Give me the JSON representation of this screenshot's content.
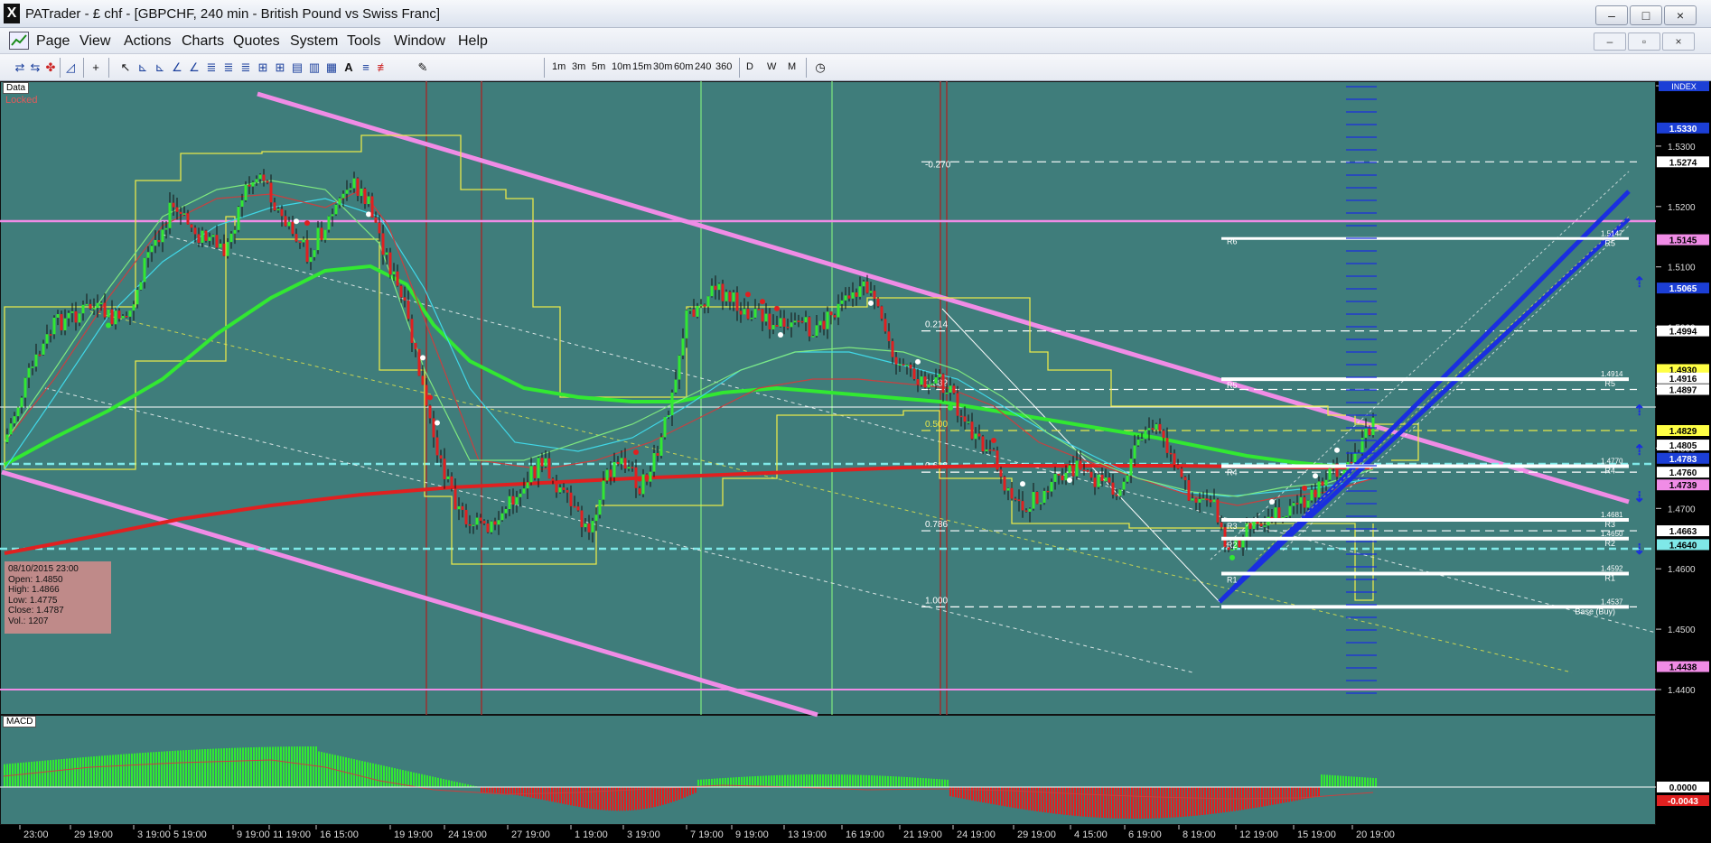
{
  "window": {
    "icon_letter": "X",
    "title": "PATrader - £ chf - [GBPCHF, 240 min - British Pound vs Swiss Franc]",
    "buttons": [
      "–",
      "□",
      "×"
    ],
    "mdi_buttons": [
      "–",
      "▫",
      "×"
    ]
  },
  "menu": [
    "Page",
    "View",
    "Actions",
    "Charts",
    "Quotes",
    "System",
    "Tools",
    "Window",
    "Help"
  ],
  "toolbar": {
    "tools": [
      "connect-icon",
      "disconnect-icon",
      "pin-icon",
      "chart-type-icon",
      "crosshair-icon",
      "pointer-icon",
      "line-tool-icon",
      "channel-tool-icon",
      "ray-tool-icon",
      "fib-tool-icon",
      "fib-fan-icon",
      "fib-arc-icon",
      "fib-time-icon",
      "gann-icon",
      "text-tool-icon",
      "pitchfork-icon",
      "regression-icon",
      "pen-icon"
    ],
    "timeframes": [
      "1m",
      "3m",
      "5m",
      "10m",
      "15m",
      "30m",
      "60m",
      "240",
      "360"
    ],
    "periods": [
      "D",
      "W",
      "M"
    ]
  },
  "chart": {
    "data_tag": "Data",
    "locked": "Locked",
    "index_tag": "INDEX",
    "macd_tag": "MACD",
    "fib_labels": [
      "-0.270",
      "0.214",
      "0.382",
      "0.500",
      "0.618",
      "0.786",
      "1.000"
    ],
    "pivot_labels_left": [
      "R6",
      "R5",
      "R4",
      "R3",
      "R2",
      "R1"
    ],
    "pivot_labels_right": [
      "R5",
      "R5",
      "R4",
      "R3",
      "R2",
      "R1",
      "Base (Buy)"
    ],
    "pivot_values": [
      "1.5147",
      "1.4914",
      "1.4770",
      "1.4681",
      "1.4650",
      "1.4592",
      "1.4537"
    ],
    "price_axis": [
      "1.5400",
      "1.5300",
      "1.5200",
      "1.5100",
      "1.5000",
      "1.4900",
      "1.4800",
      "1.4700",
      "1.4600",
      "1.4500",
      "1.4400"
    ],
    "price_tags": [
      {
        "v": "1.5330",
        "bg": "#1c3fd6",
        "fg": "#ffffff"
      },
      {
        "v": "1.5274",
        "bg": "#ffffff",
        "fg": "#000000"
      },
      {
        "v": "1.5145",
        "bg": "#f08ce6",
        "fg": "#000000"
      },
      {
        "v": "1.5065",
        "bg": "#1c3fd6",
        "fg": "#ffffff"
      },
      {
        "v": "1.4994",
        "bg": "#ffffff",
        "fg": "#000000"
      },
      {
        "v": "1.4930",
        "bg": "#ffff44",
        "fg": "#000000"
      },
      {
        "v": "1.4916",
        "bg": "#ffffff",
        "fg": "#000000"
      },
      {
        "v": "1.4897",
        "bg": "#ffffff",
        "fg": "#000000"
      },
      {
        "v": "1.4829",
        "bg": "#ffff44",
        "fg": "#000000"
      },
      {
        "v": "1.4805",
        "bg": "#ffffff",
        "fg": "#000000"
      },
      {
        "v": "1.4783",
        "bg": "#1c3fd6",
        "fg": "#ffffff"
      },
      {
        "v": "1.4760",
        "bg": "#ffffff",
        "fg": "#000000"
      },
      {
        "v": "1.4739",
        "bg": "#f08ce6",
        "fg": "#000000"
      },
      {
        "v": "1.4663",
        "bg": "#ffffff",
        "fg": "#000000"
      },
      {
        "v": "1.4640",
        "bg": "#7fe8e8",
        "fg": "#000000"
      },
      {
        "v": "1.4438",
        "bg": "#f08ce6",
        "fg": "#000000"
      }
    ],
    "macd_axis": [
      {
        "v": "0.0000",
        "bg": "#ffffff",
        "fg": "#000000"
      },
      {
        "v": "-0.0043",
        "bg": "#e02020",
        "fg": "#ffffff"
      }
    ],
    "date_axis": [
      "23:00",
      "29 19:00",
      "3 19:00",
      "5 19:00",
      "9 19:00",
      "11 19:00",
      "16 15:00",
      "19 19:00",
      "24 19:00",
      "27 19:00",
      "1 19:00",
      "3 19:00",
      "7 19:00",
      "9 19:00",
      "13 19:00",
      "16 19:00",
      "21 19:00",
      "24 19:00",
      "29 19:00",
      "4 15:00",
      "6 19:00",
      "8 19:00",
      "12 19:00",
      "15 19:00",
      "20 19:00"
    ]
  },
  "ohlc_box": {
    "date": "08/10/2015 23:00",
    "open": "Open: 1.4850",
    "high": "High: 1.4866",
    "low": "Low: 1.4775",
    "close": "Close: 1.4787",
    "vol": "Vol.: 1207"
  },
  "colors": {
    "background": "#3f7d7b",
    "bull": "#32e832",
    "bear": "#e02020",
    "channel": "#f08ce6",
    "trend_blue": "#1a2ee0"
  }
}
